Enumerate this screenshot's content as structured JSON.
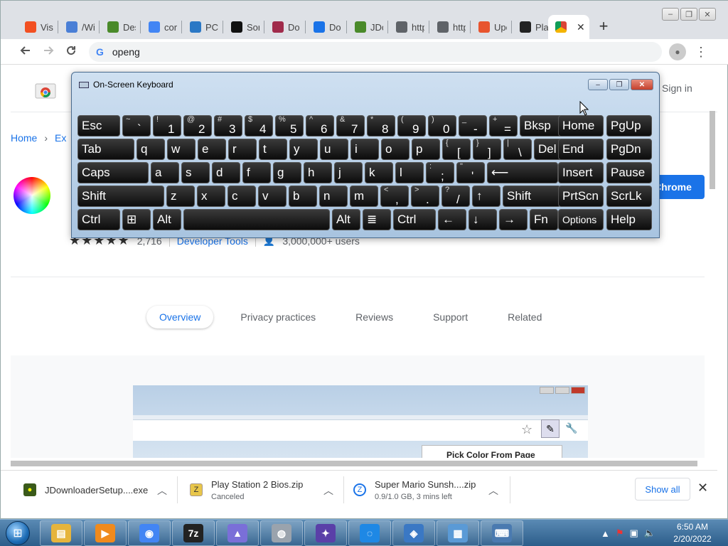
{
  "browser": {
    "tabs": [
      {
        "label": "Visi",
        "icon": "windows-logo-icon",
        "color": "#f25022"
      },
      {
        "label": "/Wi",
        "icon": "folder-icon",
        "color": "#4a7fd6"
      },
      {
        "label": "Des",
        "icon": "jdownloader-icon",
        "color": "#4a8a2a"
      },
      {
        "label": "cor",
        "icon": "google-icon",
        "color": "#4285f4"
      },
      {
        "label": "PC",
        "icon": "ghost-icon",
        "color": "#2b78c5"
      },
      {
        "label": "Sor",
        "icon": "cn-icon",
        "color": "#111111"
      },
      {
        "label": "Do",
        "icon": "robot-icon",
        "color": "#a02b4b"
      },
      {
        "label": "Do",
        "icon": "download-icon",
        "color": "#1a73e8"
      },
      {
        "label": "JDc",
        "icon": "jdownloader-icon",
        "color": "#4a8a2a"
      },
      {
        "label": "http",
        "icon": "globe-icon",
        "color": "#5f6368"
      },
      {
        "label": "http",
        "icon": "globe-icon",
        "color": "#5f6368"
      },
      {
        "label": "Upc",
        "icon": "upload-icon",
        "color": "#e8542e"
      },
      {
        "label": "Pla",
        "icon": "library-icon",
        "color": "#222222"
      }
    ],
    "active_tab_close": "✕",
    "new_tab": "+",
    "address": "openg",
    "omnibox_g": "G",
    "window_buttons": [
      "–",
      "❐",
      "✕"
    ]
  },
  "page": {
    "signin": "Sign in",
    "breadcrumb": {
      "home": "Home",
      "ext": "Ex"
    },
    "add_to_chrome": "Chrome",
    "rating_count": "2,716",
    "category": "Developer Tools",
    "users": "3,000,000+ users",
    "stars": "★★★★★",
    "nav_tabs": [
      "Overview",
      "Privacy practices",
      "Reviews",
      "Support",
      "Related"
    ],
    "screenshot_popup": "Pick Color From Page"
  },
  "downloads": [
    {
      "name": "JDownloaderSetup....exe",
      "meta": ""
    },
    {
      "name": "Play Station 2 Bios.zip",
      "meta": "Canceled"
    },
    {
      "name": "Super Mario Sunsh....zip",
      "meta": "0.9/1.0 GB, 3 mins left"
    }
  ],
  "show_all": "Show all",
  "osk": {
    "title": "On-Screen Keyboard",
    "rows": [
      [
        {
          "sub": "",
          "main": "Esc"
        },
        {
          "sub": "~",
          "main": "`"
        },
        {
          "sub": "!",
          "main": "1"
        },
        {
          "sub": "@",
          "main": "2"
        },
        {
          "sub": "#",
          "main": "3"
        },
        {
          "sub": "$",
          "main": "4"
        },
        {
          "sub": "%",
          "main": "5"
        },
        {
          "sub": "^",
          "main": "6"
        },
        {
          "sub": "&",
          "main": "7"
        },
        {
          "sub": "*",
          "main": "8"
        },
        {
          "sub": "(",
          "main": "9"
        },
        {
          "sub": ")",
          "main": "0"
        },
        {
          "sub": "_",
          "main": "-"
        },
        {
          "sub": "+",
          "main": "="
        },
        {
          "sub": "",
          "main": "Bksp"
        },
        {
          "sub": "",
          "main": "Home"
        },
        {
          "sub": "",
          "main": "PgUp"
        }
      ],
      [
        {
          "sub": "",
          "main": "Tab"
        },
        {
          "sub": "",
          "main": "q"
        },
        {
          "sub": "",
          "main": "w"
        },
        {
          "sub": "",
          "main": "e"
        },
        {
          "sub": "",
          "main": "r"
        },
        {
          "sub": "",
          "main": "t"
        },
        {
          "sub": "",
          "main": "y"
        },
        {
          "sub": "",
          "main": "u"
        },
        {
          "sub": "",
          "main": "i"
        },
        {
          "sub": "",
          "main": "o"
        },
        {
          "sub": "",
          "main": "p"
        },
        {
          "sub": "{",
          "main": "["
        },
        {
          "sub": "}",
          "main": "]"
        },
        {
          "sub": "|",
          "main": "\\"
        },
        {
          "sub": "",
          "main": "Del"
        },
        {
          "sub": "",
          "main": "End"
        },
        {
          "sub": "",
          "main": "PgDn"
        }
      ],
      [
        {
          "sub": "",
          "main": "Caps"
        },
        {
          "sub": "",
          "main": "a"
        },
        {
          "sub": "",
          "main": "s"
        },
        {
          "sub": "",
          "main": "d"
        },
        {
          "sub": "",
          "main": "f"
        },
        {
          "sub": "",
          "main": "g"
        },
        {
          "sub": "",
          "main": "h"
        },
        {
          "sub": "",
          "main": "j"
        },
        {
          "sub": "",
          "main": "k"
        },
        {
          "sub": "",
          "main": "l"
        },
        {
          "sub": ":",
          "main": ";"
        },
        {
          "sub": "\"",
          "main": "'"
        },
        {
          "sub": "",
          "main": "⟵"
        },
        {
          "sub": "",
          "main": "Insert"
        },
        {
          "sub": "",
          "main": "Pause"
        }
      ],
      [
        {
          "sub": "",
          "main": "Shift"
        },
        {
          "sub": "",
          "main": "z"
        },
        {
          "sub": "",
          "main": "x"
        },
        {
          "sub": "",
          "main": "c"
        },
        {
          "sub": "",
          "main": "v"
        },
        {
          "sub": "",
          "main": "b"
        },
        {
          "sub": "",
          "main": "n"
        },
        {
          "sub": "",
          "main": "m"
        },
        {
          "sub": "<",
          "main": ","
        },
        {
          "sub": ">",
          "main": "."
        },
        {
          "sub": "?",
          "main": "/"
        },
        {
          "sub": "",
          "main": "↑"
        },
        {
          "sub": "",
          "main": "Shift"
        },
        {
          "sub": "",
          "main": "PrtScn"
        },
        {
          "sub": "",
          "main": "ScrLk"
        }
      ],
      [
        {
          "sub": "",
          "main": "Ctrl"
        },
        {
          "sub": "",
          "main": "⊞"
        },
        {
          "sub": "",
          "main": "Alt"
        },
        {
          "sub": "",
          "main": ""
        },
        {
          "sub": "",
          "main": "Alt"
        },
        {
          "sub": "",
          "main": "≣"
        },
        {
          "sub": "",
          "main": "Ctrl"
        },
        {
          "sub": "",
          "main": "←"
        },
        {
          "sub": "",
          "main": "↓"
        },
        {
          "sub": "",
          "main": "→"
        },
        {
          "sub": "",
          "main": "Fn"
        },
        {
          "sub": "",
          "main": "Options"
        },
        {
          "sub": "",
          "main": "Help"
        }
      ]
    ]
  },
  "taskbar": {
    "items": [
      {
        "icon": "file-explorer-icon",
        "color": "#e6b43c",
        "glyph": "▤"
      },
      {
        "icon": "media-player-icon",
        "color": "#f08a1c",
        "glyph": "▶"
      },
      {
        "icon": "chrome-icon",
        "color": "#4285f4",
        "glyph": "◉"
      },
      {
        "icon": "7zip-icon",
        "color": "#222222",
        "glyph": "7z"
      },
      {
        "icon": "app-icon",
        "color": "#7a6fd8",
        "glyph": "▲"
      },
      {
        "icon": "speaker-icon",
        "color": "#9aa3ad",
        "glyph": "◍"
      },
      {
        "icon": "pcsx2-icon",
        "color": "#5a3fa8",
        "glyph": "✦"
      },
      {
        "icon": "shield-app-icon",
        "color": "#1e88e5",
        "glyph": "◌"
      },
      {
        "icon": "network-app-icon",
        "color": "#3a78c4",
        "glyph": "◈"
      },
      {
        "icon": "control-panel-icon",
        "color": "#5a9ad6",
        "glyph": "▦"
      },
      {
        "icon": "on-screen-keyboard-icon",
        "color": "#4a7ab0",
        "glyph": "⌨"
      }
    ],
    "time": "6:50 AM",
    "date": "2/20/2022"
  }
}
